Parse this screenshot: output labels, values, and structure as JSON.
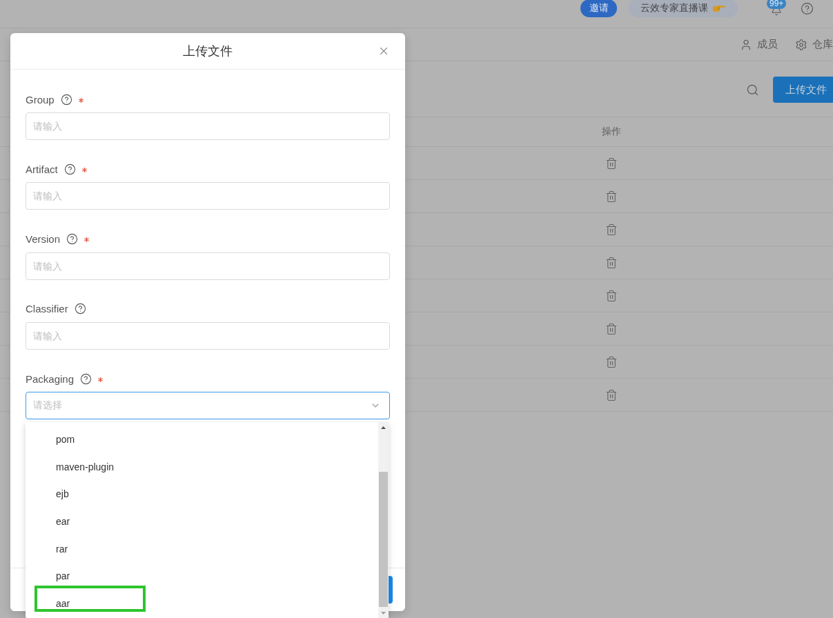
{
  "top_bar": {
    "invite_button": "邀请",
    "promo_pill": "云效专家直播课",
    "notification_badge": "99+"
  },
  "nav": {
    "members_link": "成员",
    "repo_link": "仓库"
  },
  "toolbar": {
    "upload_button": "上传文件"
  },
  "table": {
    "columns": [
      "操作"
    ],
    "rows": [
      {
        "kind": "delete"
      },
      {
        "kind": "delete"
      },
      {
        "kind": "delete"
      },
      {
        "kind": "delete"
      },
      {
        "kind": "delete"
      },
      {
        "kind": "delete"
      },
      {
        "kind": "delete"
      },
      {
        "kind": "delete"
      }
    ]
  },
  "modal": {
    "title": "上传文件",
    "fields": [
      {
        "kind": "input",
        "label": "Group",
        "help": true,
        "required": true,
        "placeholder": "请输入"
      },
      {
        "kind": "input",
        "label": "Artifact",
        "help": true,
        "required": true,
        "placeholder": "请输入"
      },
      {
        "kind": "input",
        "label": "Version",
        "help": true,
        "required": true,
        "placeholder": "请输入"
      },
      {
        "kind": "input",
        "label": "Classifier",
        "help": true,
        "required": false,
        "placeholder": "请输入"
      },
      {
        "kind": "select",
        "label": "Packaging",
        "help": true,
        "required": true,
        "placeholder": "请选择",
        "focused": true,
        "open": true,
        "options": [
          {
            "label": "pom",
            "highlighted": false
          },
          {
            "label": "maven-plugin",
            "highlighted": false
          },
          {
            "label": "ejb",
            "highlighted": false
          },
          {
            "label": "ear",
            "highlighted": false
          },
          {
            "label": "rar",
            "highlighted": false
          },
          {
            "label": "par",
            "highlighted": false
          },
          {
            "label": "aar",
            "highlighted": true
          }
        ]
      }
    ]
  }
}
